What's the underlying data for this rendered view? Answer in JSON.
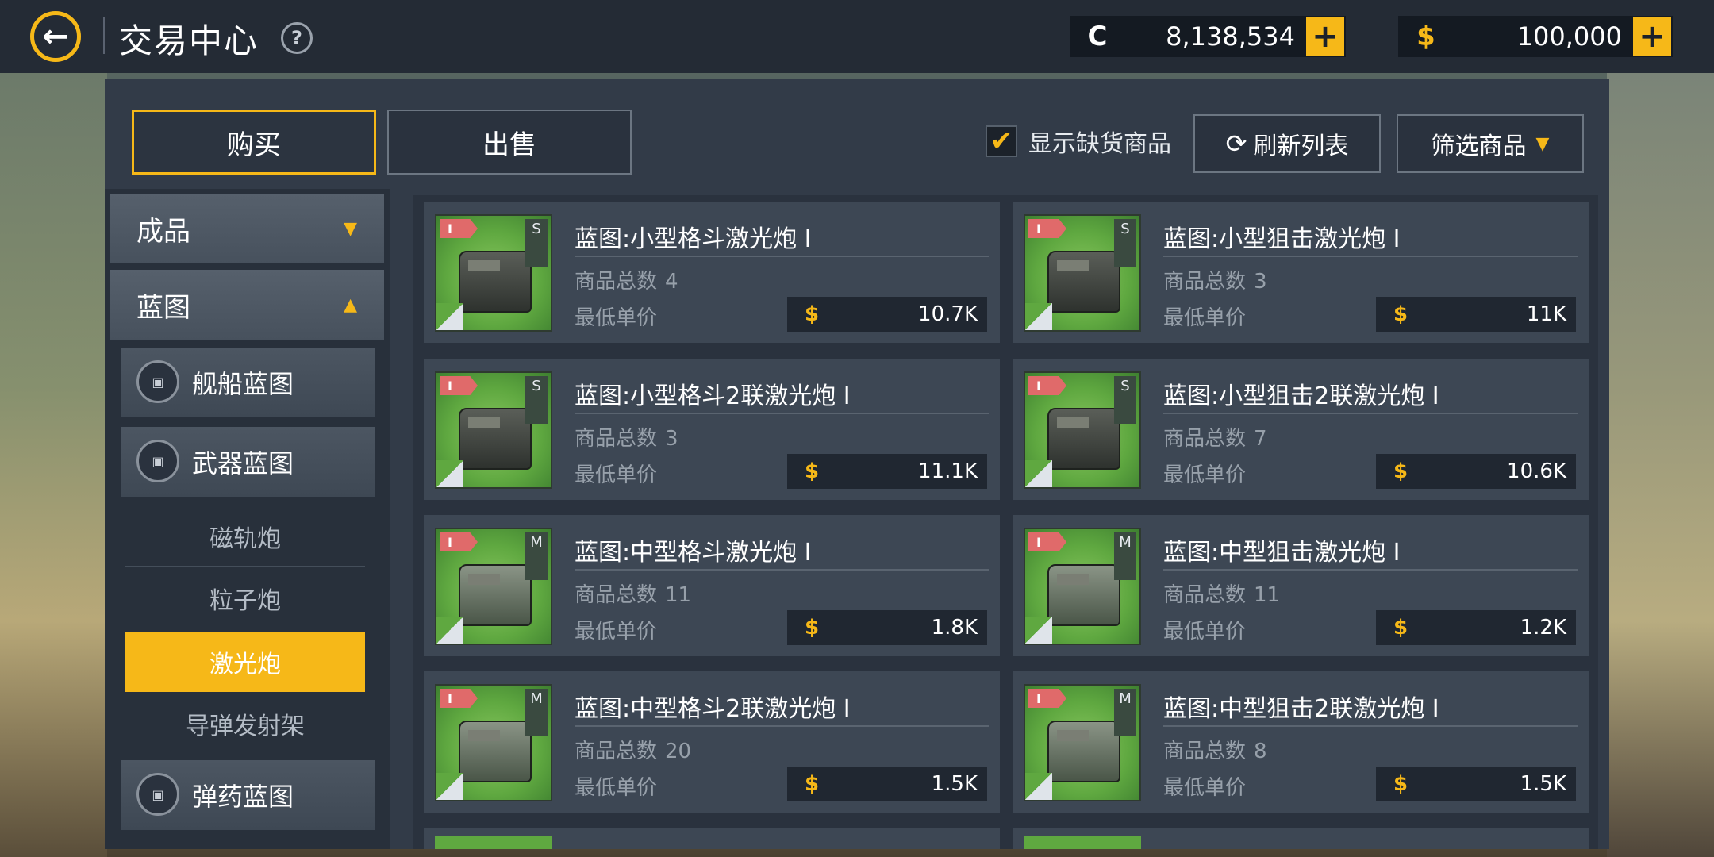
{
  "header": {
    "title": "交易中心",
    "help": "?",
    "back_icon": "←",
    "currencies": [
      {
        "symbol": "C",
        "value": "8,138,534",
        "add": "+"
      },
      {
        "symbol": "$",
        "value": "100,000",
        "add": "+"
      }
    ]
  },
  "tabs": {
    "buy": "购买",
    "sell": "出售"
  },
  "toolbar": {
    "show_out_of_stock": "显示缺货商品",
    "checked_mark": "✔",
    "refresh": "刷新列表",
    "refresh_icon": "⟳",
    "filter": "筛选商品",
    "filter_caret": "▼"
  },
  "sidebar": {
    "categories": [
      {
        "label": "成品",
        "indicator": "▼"
      },
      {
        "label": "蓝图",
        "indicator": "▲"
      }
    ],
    "subcategories": [
      {
        "label": "舰船蓝图"
      },
      {
        "label": "武器蓝图"
      },
      {
        "label": "弹药蓝图"
      }
    ],
    "weapon_types": [
      "磁轨炮",
      "粒子炮",
      "激光炮",
      "导弹发射架"
    ],
    "selected": "激光炮"
  },
  "items_labels": {
    "count": "商品总数",
    "lowest": "最低单价",
    "currency": "$"
  },
  "items": [
    {
      "name": "蓝图:小型格斗激光炮 I",
      "tier": "I",
      "size": "S",
      "count": "4",
      "price": "10.7K"
    },
    {
      "name": "蓝图:小型狙击激光炮 I",
      "tier": "I",
      "size": "S",
      "count": "3",
      "price": "11K"
    },
    {
      "name": "蓝图:小型格斗2联激光炮 I",
      "tier": "I",
      "size": "S",
      "count": "3",
      "price": "11.1K"
    },
    {
      "name": "蓝图:小型狙击2联激光炮 I",
      "tier": "I",
      "size": "S",
      "count": "7",
      "price": "10.6K"
    },
    {
      "name": "蓝图:中型格斗激光炮 I",
      "tier": "I",
      "size": "M",
      "count": "11",
      "price": "1.8K"
    },
    {
      "name": "蓝图:中型狙击激光炮 I",
      "tier": "I",
      "size": "M",
      "count": "11",
      "price": "1.2K"
    },
    {
      "name": "蓝图:中型格斗2联激光炮 I",
      "tier": "I",
      "size": "M",
      "count": "20",
      "price": "1.5K"
    },
    {
      "name": "蓝图:中型狙击2联激光炮 I",
      "tier": "I",
      "size": "M",
      "count": "8",
      "price": "1.5K"
    }
  ],
  "colors": {
    "accent": "#f6b818",
    "panel": "#323b48",
    "topbar": "#242b35"
  }
}
